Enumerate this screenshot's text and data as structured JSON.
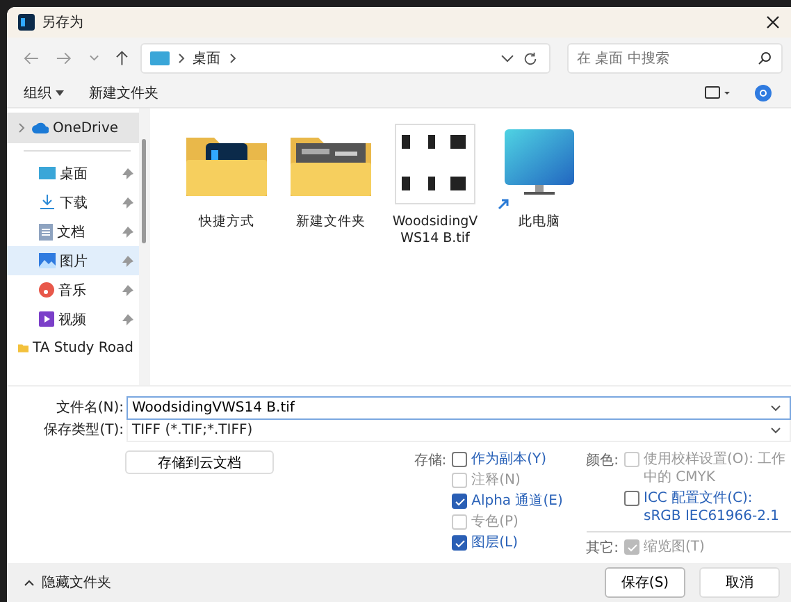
{
  "window": {
    "title": "另存为"
  },
  "nav": {
    "path": [
      "桌面"
    ],
    "search": {
      "placeholder": "在 桌面 中搜索"
    }
  },
  "toolbar": {
    "organize": "组织",
    "new_folder": "新建文件夹"
  },
  "sidebar": {
    "items": [
      {
        "label": "OneDrive",
        "kind": "cloud",
        "expandable": true,
        "pinned": false,
        "selected": false,
        "hovered": true
      },
      {
        "label": "桌面",
        "kind": "desktop",
        "expandable": false,
        "pinned": true,
        "selected": false,
        "hovered": false
      },
      {
        "label": "下载",
        "kind": "download",
        "expandable": false,
        "pinned": true,
        "selected": false,
        "hovered": false
      },
      {
        "label": "文档",
        "kind": "documents",
        "expandable": false,
        "pinned": true,
        "selected": false,
        "hovered": false
      },
      {
        "label": "图片",
        "kind": "pictures",
        "expandable": false,
        "pinned": true,
        "selected": true,
        "hovered": false
      },
      {
        "label": "音乐",
        "kind": "music",
        "expandable": false,
        "pinned": true,
        "selected": false,
        "hovered": false
      },
      {
        "label": "视频",
        "kind": "videos",
        "expandable": false,
        "pinned": true,
        "selected": false,
        "hovered": false
      },
      {
        "label": "TA Study Road",
        "kind": "folder",
        "expandable": false,
        "pinned": false,
        "selected": false,
        "hovered": false
      }
    ]
  },
  "files": [
    {
      "name": "快捷方式",
      "kind": "ps-folder",
      "shortcut": false
    },
    {
      "name": "新建文件夹",
      "kind": "photo-folder",
      "shortcut": false
    },
    {
      "name": "WoodsidingVWS14 B.tif",
      "kind": "image",
      "shortcut": false
    },
    {
      "name": "此电脑",
      "kind": "pc",
      "shortcut": true
    }
  ],
  "form": {
    "file_name": {
      "label": "文件名(N):",
      "value": "WoodsidingVWS14 B.tif"
    },
    "file_type": {
      "label": "保存类型(T):",
      "value": "TIFF (*.TIF;*.TIFF)"
    },
    "cloud_button": "存储到云文档"
  },
  "save_options": {
    "label": "存储:",
    "items": [
      {
        "label": "作为副本(Y)",
        "checked": false,
        "disabled": false
      },
      {
        "label": "注释(N)",
        "checked": false,
        "disabled": true
      },
      {
        "label": "Alpha 通道(E)",
        "checked": true,
        "disabled": false
      },
      {
        "label": "专色(P)",
        "checked": false,
        "disabled": true
      },
      {
        "label": "图层(L)",
        "checked": true,
        "disabled": false
      }
    ]
  },
  "color_options": {
    "label": "颜色:",
    "items": [
      {
        "label": "使用校样设置(O): 工作中的 CMYK",
        "checked": false,
        "disabled": true
      },
      {
        "label": "ICC 配置文件(C): sRGB IEC61966-2.1",
        "checked": false,
        "disabled": false
      }
    ]
  },
  "other_options": {
    "label": "其它:",
    "items": [
      {
        "label": "缩览图(T)",
        "checked": true,
        "disabled": true
      }
    ]
  },
  "footer": {
    "hide_folders": "隐藏文件夹",
    "buttons": [
      {
        "label": "保存(S)",
        "kind": "primary"
      },
      {
        "label": "取消",
        "kind": "secondary"
      }
    ]
  }
}
